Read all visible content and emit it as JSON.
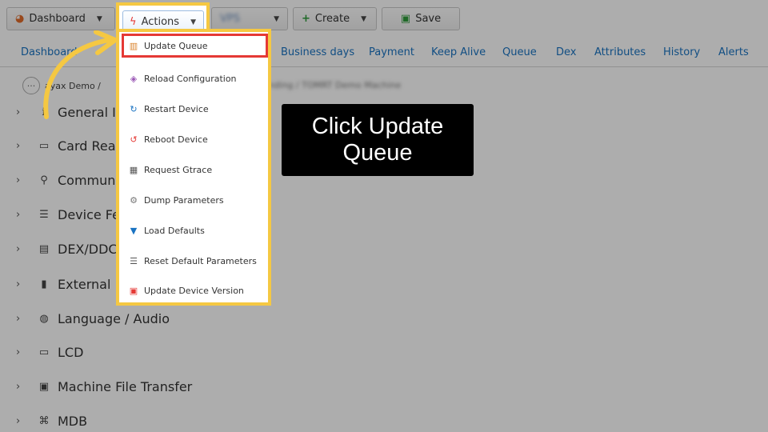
{
  "toolbar": {
    "dashboard_label": "Dashboard",
    "actions_label": "Actions",
    "blurred_label": "VPS",
    "create_label": "Create",
    "save_label": "Save"
  },
  "tabs": [
    {
      "label": "Dashboard"
    },
    {
      "label": "Business days"
    },
    {
      "label": "Payment"
    },
    {
      "label": "Keep Alive"
    },
    {
      "label": "Queue"
    },
    {
      "label": "Dex"
    },
    {
      "label": "Attributes"
    },
    {
      "label": "History"
    },
    {
      "label": "Alerts"
    }
  ],
  "breadcrumb": {
    "text": "ayax Demo /",
    "blurred_text": "Vending / TOMRT Demo Machine"
  },
  "tree": [
    {
      "label": "General In",
      "icon": "info-icon"
    },
    {
      "label": "Card Read",
      "icon": "card-reader-icon"
    },
    {
      "label": "Communi",
      "icon": "antenna-icon"
    },
    {
      "label": "Device Fea",
      "icon": "features-icon"
    },
    {
      "label": "DEX/DDCM",
      "icon": "dex-icon"
    },
    {
      "label": "External R",
      "icon": "external-icon"
    },
    {
      "label": "Language / Audio",
      "icon": "globe-icon"
    },
    {
      "label": "LCD",
      "icon": "lcd-icon"
    },
    {
      "label": "Machine File Transfer",
      "icon": "file-transfer-icon"
    },
    {
      "label": "MDB",
      "icon": "mdb-icon"
    }
  ],
  "menu": [
    {
      "label": "Update Queue",
      "icon": "queue-icon",
      "color": "#d9822b"
    },
    {
      "label": "Reload Configuration",
      "icon": "reload-icon",
      "color": "#9b59b6"
    },
    {
      "label": "Restart Device",
      "icon": "restart-icon",
      "color": "#1a73c2"
    },
    {
      "label": "Reboot Device",
      "icon": "reboot-icon",
      "color": "#e53935"
    },
    {
      "label": "Request Gtrace",
      "icon": "gtrace-icon",
      "color": "#555555"
    },
    {
      "label": "Dump Parameters",
      "icon": "gear-icon",
      "color": "#777777"
    },
    {
      "label": "Load Defaults",
      "icon": "load-icon",
      "color": "#1a73c2"
    },
    {
      "label": "Reset Default Parameters",
      "icon": "list-icon",
      "color": "#555555"
    },
    {
      "label": "Update Device Version",
      "icon": "device-version-icon",
      "color": "#e53935"
    }
  ],
  "callout": {
    "text": "Click Update Queue"
  },
  "colors": {
    "highlight_yellow": "#f5c842",
    "highlight_red": "#e53935",
    "link_blue": "#1a73c2"
  }
}
